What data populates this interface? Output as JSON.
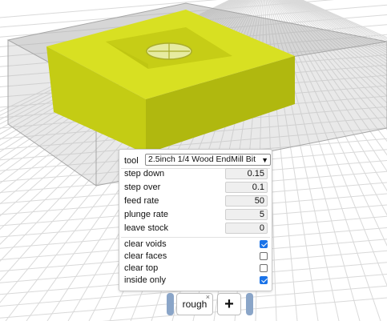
{
  "colors": {
    "part": "#d4dc1e",
    "stock_outline": "#a6a6a6",
    "checkbox_on": "#1a73e8",
    "tab_cap": "#8aa5c8"
  },
  "panel": {
    "tool_label": "tool",
    "tool_value": "2.5inch 1/4 Wood EndMill Bit",
    "fields": [
      {
        "label": "step down",
        "value": "0.15"
      },
      {
        "label": "step over",
        "value": "0.1"
      },
      {
        "label": "feed rate",
        "value": "50"
      },
      {
        "label": "plunge rate",
        "value": "5"
      },
      {
        "label": "leave stock",
        "value": "0"
      }
    ],
    "options": [
      {
        "label": "clear voids",
        "checked": true
      },
      {
        "label": "clear faces",
        "checked": false
      },
      {
        "label": "clear top",
        "checked": false
      },
      {
        "label": "inside only",
        "checked": true
      }
    ]
  },
  "tabs": {
    "items": [
      {
        "label": "rough",
        "close": "×"
      }
    ],
    "add_label": "+"
  }
}
